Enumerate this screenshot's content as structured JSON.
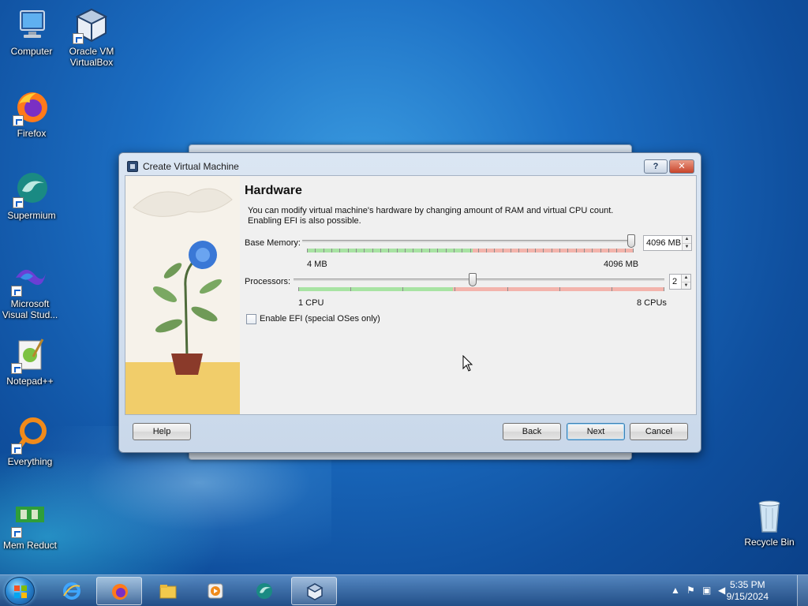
{
  "desktop": {
    "icons": [
      {
        "label": "Computer",
        "icon": "computer-icon"
      },
      {
        "label": "Oracle VM VirtualBox",
        "icon": "virtualbox-icon"
      },
      {
        "label": "Firefox",
        "icon": "firefox-icon"
      },
      {
        "label": "Supermium",
        "icon": "supermium-icon"
      },
      {
        "label": "Microsoft Visual Stud...",
        "icon": "visual-studio-icon"
      },
      {
        "label": "Notepad++",
        "icon": "notepadpp-icon"
      },
      {
        "label": "Everything",
        "icon": "everything-icon"
      },
      {
        "label": "Mem Reduct",
        "icon": "memreduct-icon"
      },
      {
        "label": "Recycle Bin",
        "icon": "recycle-bin-icon"
      }
    ]
  },
  "dialog": {
    "title": "Create Virtual Machine",
    "help_glyph": "?",
    "close_glyph": "✕",
    "heading": "Hardware",
    "description": "You can modify virtual machine's hardware by changing amount of RAM and virtual CPU count. Enabling EFI is also possible.",
    "memory": {
      "label": "Base Memory:",
      "value": "4096 MB",
      "min_label": "4 MB",
      "max_label": "4096 MB",
      "current_mb": 4096
    },
    "processors": {
      "label": "Processors:",
      "value": "2",
      "min_label": "1 CPU",
      "max_label": "8 CPUs",
      "current": 2
    },
    "efi": {
      "label": "Enable EFI (special OSes only)",
      "checked": false
    },
    "buttons": {
      "help": "Help",
      "back": "Back",
      "next": "Next",
      "cancel": "Cancel"
    }
  },
  "taskbar": {
    "items": [
      "internet-explorer-icon",
      "firefox-icon",
      "file-explorer-icon",
      "media-player-icon",
      "supermium-icon",
      "virtualbox-icon"
    ],
    "time": "5:35 PM",
    "date": "9/15/2024"
  },
  "colors": {
    "slider_green": "#9fe09f",
    "slider_red": "#f2a9a0",
    "accent": "#3c7fb1"
  }
}
